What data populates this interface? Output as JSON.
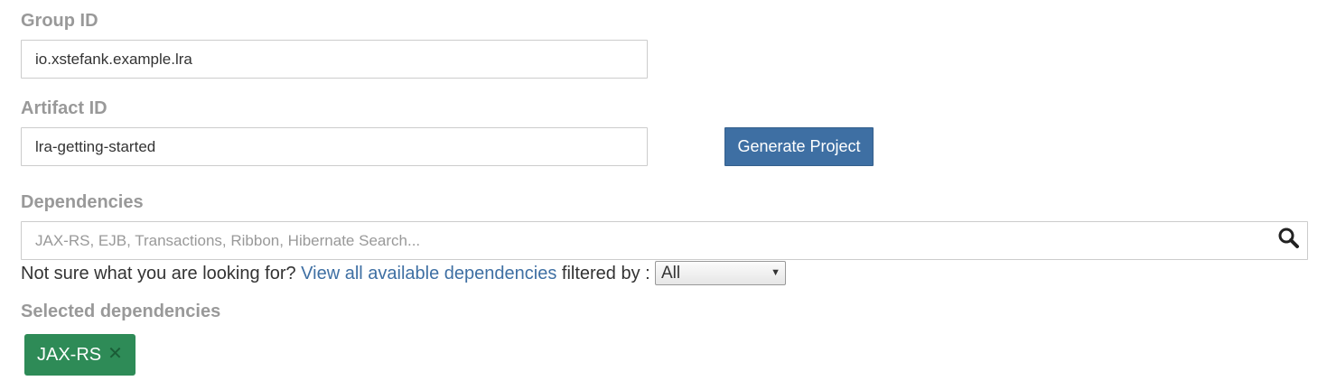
{
  "group": {
    "label": "Group ID",
    "value": "io.xstefank.example.lra"
  },
  "artifact": {
    "label": "Artifact ID",
    "value": "lra-getting-started"
  },
  "generate_button": {
    "label": "Generate Project"
  },
  "dependencies": {
    "label": "Dependencies",
    "search_placeholder": "JAX-RS, EJB, Transactions, Ribbon, Hibernate Search...",
    "search_icon": "search-icon",
    "helper_prefix": "Not sure what you are looking for? ",
    "helper_link": "View all available dependencies",
    "helper_suffix": " filtered by : ",
    "filter_selected": "All"
  },
  "selected": {
    "label": "Selected dependencies",
    "items": [
      {
        "label": "JAX-RS",
        "remove_icon": "close-icon"
      }
    ]
  },
  "colors": {
    "primary_button": "#3e6fa3",
    "link": "#3e6fa3",
    "chip": "#2e8b57",
    "label": "#999999"
  }
}
